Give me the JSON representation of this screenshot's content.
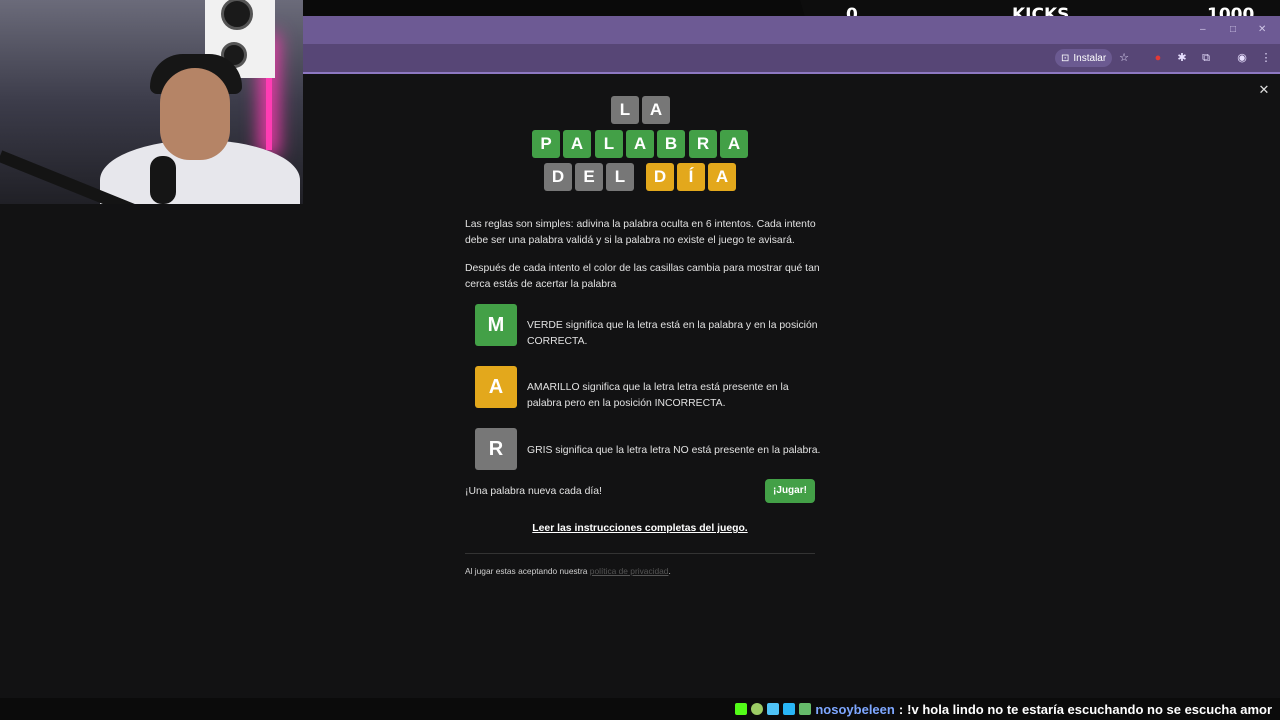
{
  "stream_overlay": {
    "kicks_left": "0",
    "kicks_label": "KICKS",
    "kicks_right": "1000"
  },
  "browser": {
    "install_label": "Instalar"
  },
  "title_tiles": {
    "row1": [
      {
        "letter": "L",
        "color": "gray"
      },
      {
        "letter": "A",
        "color": "gray"
      }
    ],
    "row2": [
      {
        "letter": "P",
        "color": "green"
      },
      {
        "letter": "A",
        "color": "green"
      },
      {
        "letter": "L",
        "color": "green"
      },
      {
        "letter": "A",
        "color": "green"
      },
      {
        "letter": "B",
        "color": "green"
      },
      {
        "letter": "R",
        "color": "green"
      },
      {
        "letter": "A",
        "color": "green"
      }
    ],
    "row3": [
      {
        "letter": "D",
        "color": "gray"
      },
      {
        "letter": "E",
        "color": "gray"
      },
      {
        "letter": "L",
        "color": "gray"
      },
      {
        "letter": "D",
        "color": "yellow"
      },
      {
        "letter": "Í",
        "color": "yellow"
      },
      {
        "letter": "A",
        "color": "yellow"
      }
    ]
  },
  "rules": {
    "intro_line1": "Las reglas son simples: adivina la palabra oculta en 6 intentos. Cada intento",
    "intro_line2": "debe ser una palabra validá y si la palabra no existe el juego te avisará.",
    "after_line1": "Después de cada intento el color de las casillas cambia para mostrar qué tan",
    "after_line2": "cerca estás de acertar la palabra",
    "examples": [
      {
        "letter": "M",
        "color": "green",
        "line1": "VERDE significa que la letra está en la palabra y en la posición",
        "line2": "CORRECTA."
      },
      {
        "letter": "A",
        "color": "yellow",
        "line1": "AMARILLO significa que la letra letra está presente en la",
        "line2": "palabra pero en la posición INCORRECTA."
      },
      {
        "letter": "R",
        "color": "gray",
        "line1": "GRIS significa que la letra letra NO está presente en la palabra.",
        "line2": ""
      }
    ],
    "daily_text": "¡Una palabra nueva cada día!",
    "play_label": "¡Jugar!",
    "instructions_link": "Leer las instrucciones completas del juego.",
    "privacy_prefix": "Al jugar estas aceptando nuestra ",
    "privacy_link": "política de privacidad",
    "privacy_suffix": "."
  },
  "chat": {
    "username": "nosoybeleen",
    "separator": ":",
    "message": "!v hola lindo  no te estaría escuchando  no se escucha amor"
  },
  "colors": {
    "green": "#43a047",
    "yellow": "#e3a81c",
    "gray": "#777777",
    "background": "#121213",
    "chrome": "#6d5a94"
  }
}
